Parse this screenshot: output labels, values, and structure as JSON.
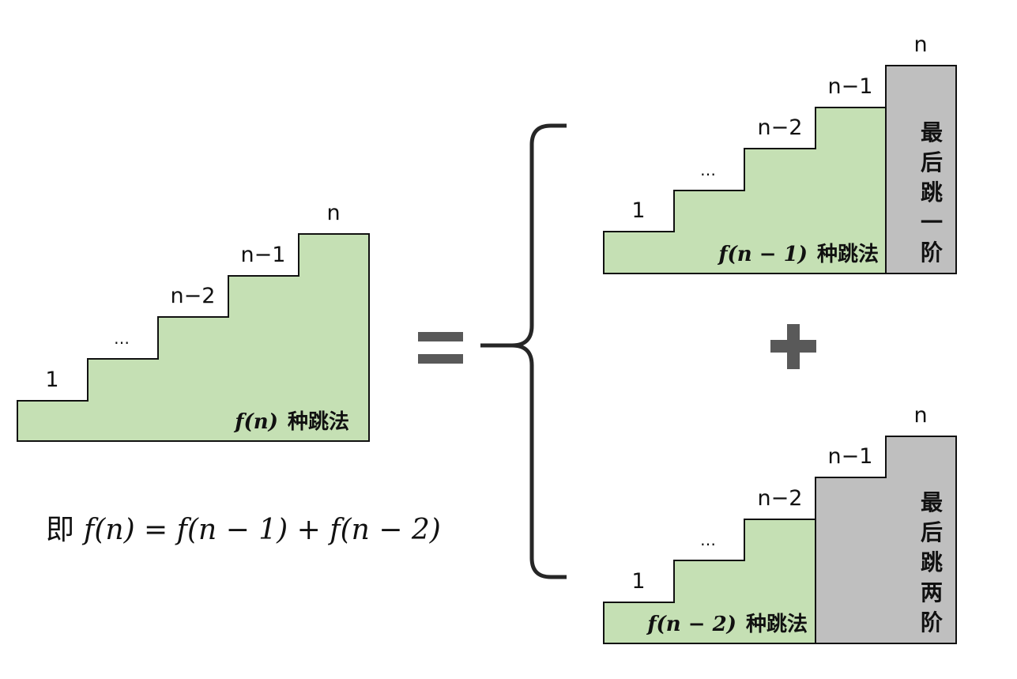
{
  "left_stair": {
    "labels": [
      "1",
      "…",
      "n−2",
      "n−1",
      "n"
    ],
    "caption_fx": "f(n)",
    "caption_text": "种跳法"
  },
  "top_right": {
    "labels": [
      "1",
      "…",
      "n−2",
      "n−1",
      "n"
    ],
    "caption_fx": "f(n − 1)",
    "caption_text": "种跳法",
    "last_step_chars": [
      "最",
      "后",
      "跳",
      "一",
      "阶"
    ]
  },
  "bottom_right": {
    "labels": [
      "1",
      "…",
      "n−2",
      "n−1",
      "n"
    ],
    "caption_fx": "f(n − 2)",
    "caption_text": "种跳法",
    "last_step_chars": [
      "最",
      "后",
      "跳",
      "两",
      "阶"
    ]
  },
  "formula": {
    "prefix": "即",
    "expression": "f(n) = f(n − 1) + f(n − 2)"
  },
  "symbols": {
    "equals": "equals-sign",
    "plus": "plus-sign",
    "brace": "left-curly-brace"
  },
  "colors": {
    "step_fill": "#c5e0b4",
    "last_step_fill": "#bfbfbf",
    "outline": "#111111",
    "symbol": "#595959",
    "brace": "#262626"
  }
}
